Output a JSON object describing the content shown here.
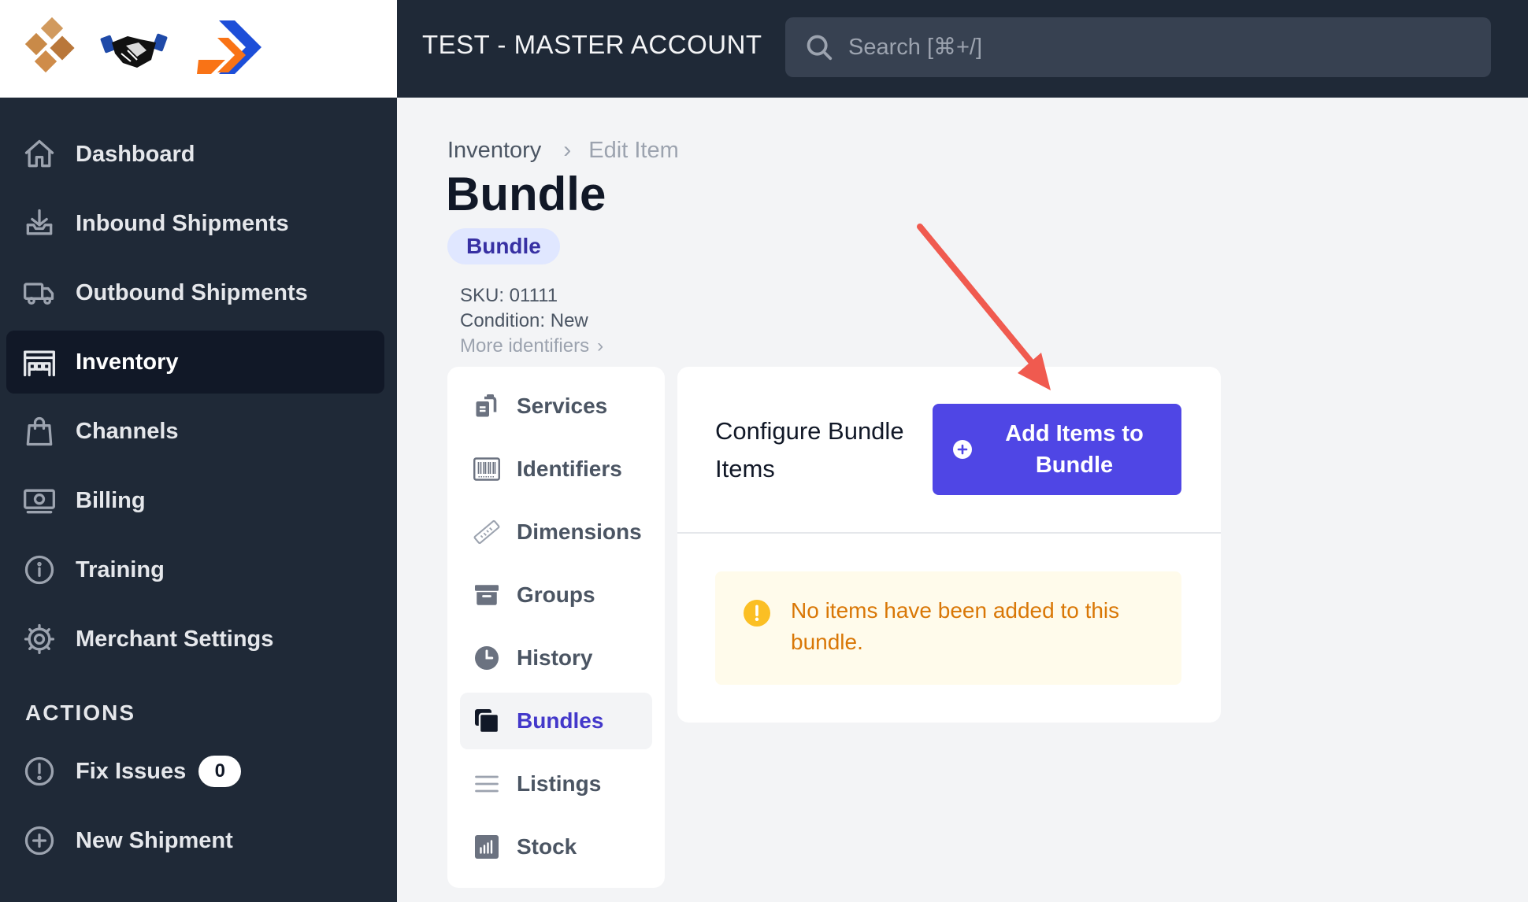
{
  "header": {
    "account_title": "TEST - MASTER ACCOUNT",
    "search_placeholder": "Search [⌘+/]"
  },
  "sidebar": {
    "items": [
      {
        "label": "Dashboard",
        "icon": "home-icon"
      },
      {
        "label": "Inbound Shipments",
        "icon": "inbox-icon"
      },
      {
        "label": "Outbound Shipments",
        "icon": "truck-icon"
      },
      {
        "label": "Inventory",
        "icon": "warehouse-icon",
        "active": true
      },
      {
        "label": "Channels",
        "icon": "shopping-bag-icon"
      },
      {
        "label": "Billing",
        "icon": "cash-icon"
      },
      {
        "label": "Training",
        "icon": "info-circle-icon"
      },
      {
        "label": "Merchant Settings",
        "icon": "cog-icon"
      }
    ],
    "actions_title": "ACTIONS",
    "actions": [
      {
        "label": "Fix Issues",
        "icon": "exclamation-circle-icon",
        "count": "0"
      },
      {
        "label": "New Shipment",
        "icon": "plus-circle-icon"
      }
    ]
  },
  "breadcrumb": {
    "parent": "Inventory",
    "current": "Edit Item"
  },
  "item": {
    "title": "Bundle",
    "type_badge": "Bundle",
    "sku": "SKU: 01111",
    "condition": "Condition: New",
    "more_identifiers": "More identifiers"
  },
  "subnav": {
    "items": [
      {
        "label": "Services",
        "icon": "clipboard-copy-icon"
      },
      {
        "label": "Identifiers",
        "icon": "barcode-icon"
      },
      {
        "label": "Dimensions",
        "icon": "ruler-icon"
      },
      {
        "label": "Groups",
        "icon": "archive-icon"
      },
      {
        "label": "History",
        "icon": "clock-icon"
      },
      {
        "label": "Bundles",
        "icon": "collection-icon",
        "active": true
      },
      {
        "label": "Listings",
        "icon": "menu-lines-icon"
      },
      {
        "label": "Stock",
        "icon": "chart-bar-icon"
      }
    ]
  },
  "bundle_card": {
    "title": "Configure Bundle Items",
    "add_button_label": "Add Items to Bundle",
    "empty_message": "No items have been added to this bundle."
  },
  "colors": {
    "sidebar_bg": "#1f2937",
    "primary": "#4f46e5",
    "badge_bg": "#e0e7ff",
    "warning_text": "#d97706",
    "warning_bg": "#fffbeb",
    "annotation_arrow": "#f05a4f"
  }
}
